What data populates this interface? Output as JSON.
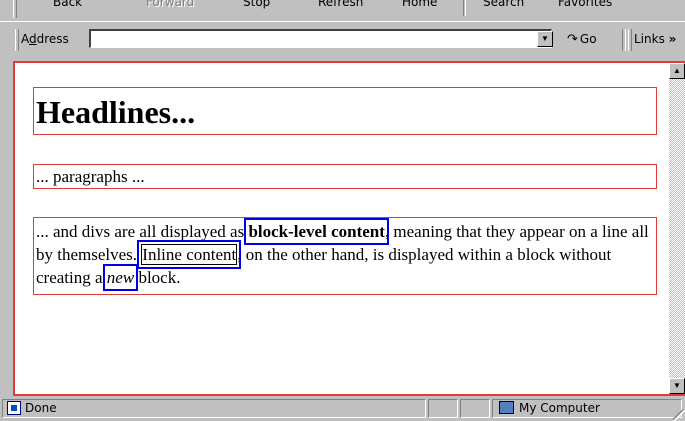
{
  "toolbar": {
    "back_label": "Back",
    "forward_label": "Forward",
    "stop_label": "Stop",
    "refresh_label": "Refresh",
    "home_label": "Home",
    "search_label": "Search",
    "favorites_label": "Favorites"
  },
  "address_bar": {
    "label_prefix": "A",
    "label_underlined": "d",
    "label_suffix": "dress",
    "value": "",
    "go_label": "Go",
    "links_label": "Links"
  },
  "content": {
    "headline": "Headlines...",
    "paragraph": "... paragraphs ...",
    "div_text_1": "... and divs are all displayed as ",
    "block_level_label": "block-level content",
    "div_text_2": ", meaning that they appear on a line all by themselves. ",
    "inline_label": "Inline content",
    "div_text_3": ", on the other hand, is displayed within a block without creating a ",
    "new_label": "new",
    "div_text_4": " block."
  },
  "status_bar": {
    "status_text": "Done",
    "zone_text": "My Computer"
  },
  "colors": {
    "block_outline": "#e23a3a",
    "highlight_outline": "#0000e8",
    "chrome": "#c0c0c0"
  }
}
